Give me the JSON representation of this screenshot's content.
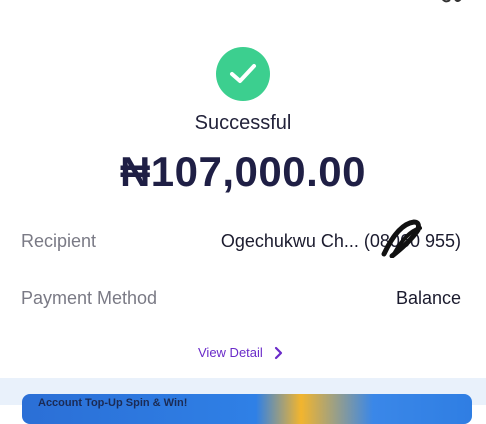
{
  "status": {
    "icon": "check-circle-icon",
    "text": "Successful",
    "color": "#3ccf8f"
  },
  "amount": "₦107,000.00",
  "details": {
    "recipient_label": "Recipient",
    "recipient_value": "Ogechukwu Ch...  (08060     955)",
    "payment_method_label": "Payment Method",
    "payment_method_value": "Balance"
  },
  "view_detail": {
    "label": "View Detail",
    "icon": "chevron-right-icon",
    "color": "#6a2bc9"
  },
  "banner": {
    "text": "Account Top-Up Spin & Win!"
  }
}
